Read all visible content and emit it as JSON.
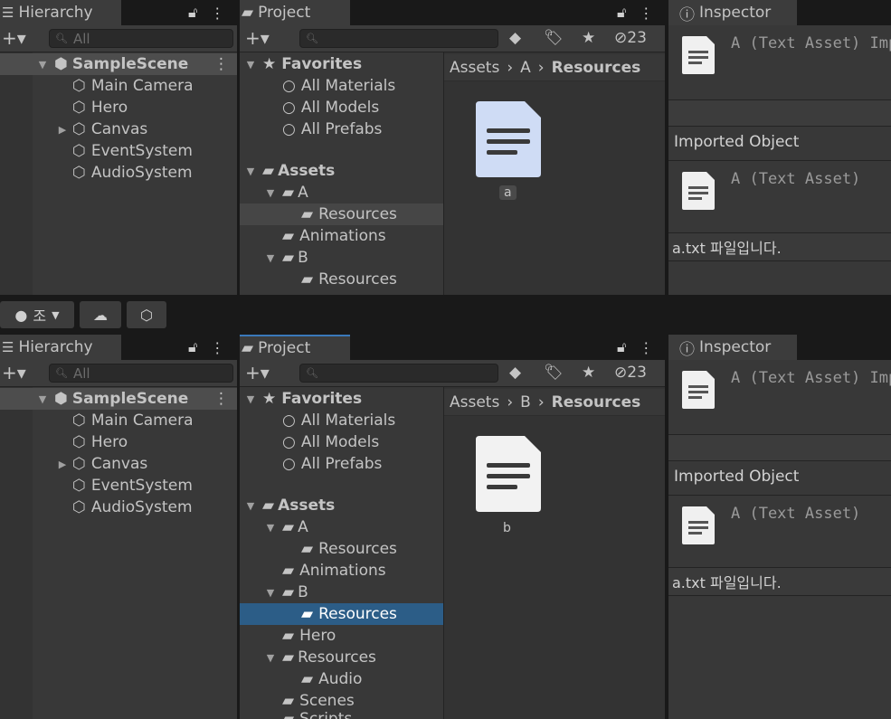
{
  "hierarchy": {
    "tab": "Hierarchy",
    "search_placeholder": "All",
    "scene": "SampleScene",
    "items": [
      "Main Camera",
      "Hero",
      "Canvas",
      "EventSystem",
      "AudioSystem"
    ]
  },
  "project": {
    "tab": "Project",
    "hidden_count": "23",
    "favorites": {
      "label": "Favorites",
      "items": [
        "All Materials",
        "All Models",
        "All Prefabs"
      ]
    },
    "assets_label": "Assets",
    "top": {
      "tree": [
        "A",
        "Resources",
        "Animations",
        "B",
        "Resources"
      ],
      "breadcrumb": [
        "Assets",
        "A",
        "Resources"
      ],
      "file": "a"
    },
    "bottom": {
      "tree": [
        "A",
        "Resources",
        "Animations",
        "B",
        "Resources",
        "Hero",
        "Resources",
        "Audio",
        "Scenes",
        "Scripts"
      ],
      "breadcrumb": [
        "Assets",
        "B",
        "Resources"
      ],
      "file": "b"
    }
  },
  "inspector": {
    "tab": "Inspector",
    "header_title": "A (Text Asset) Imp",
    "imported_label": "Imported Object",
    "asset_title": "A (Text Asset)",
    "content": "a.txt 파일입니다."
  },
  "toolbar_mid": {
    "account_label": "조"
  },
  "colors": {
    "selection": "#2c5d87",
    "tab_accent": "#3a79bb",
    "panel": "#383838",
    "header": "#3c3c3c"
  }
}
